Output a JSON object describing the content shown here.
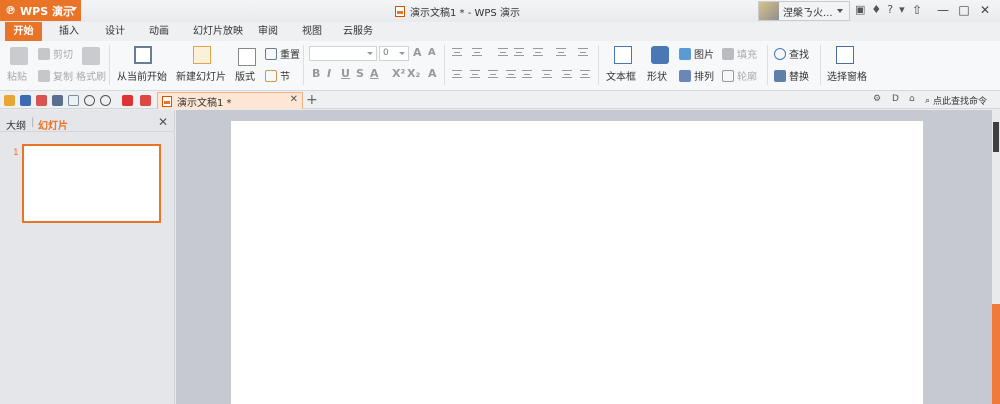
{
  "titlebar": {
    "app_name": "WPS 演示",
    "title": "演示文稿1 * - WPS 演示",
    "user_name": "涅槃ㄋ火..."
  },
  "menu": {
    "tabs": [
      "开始",
      "插入",
      "设计",
      "动画",
      "幻灯片放映",
      "审阅",
      "视图",
      "云服务"
    ],
    "active": "开始"
  },
  "ribbon": {
    "clipboard": {
      "paste": "粘贴",
      "cut": "剪切",
      "copy": "复制",
      "format_painter": "格式刷"
    },
    "slides": {
      "from_current": "从当前开始",
      "new_slide": "新建幻灯片",
      "layout": "版式",
      "reset": "重置",
      "section": "节"
    },
    "font": {
      "font_name": "",
      "font_size": "0"
    },
    "drawing": {
      "textbox": "文本框",
      "shape": "形状",
      "picture": "图片",
      "fill": "填充",
      "arrange": "排列",
      "outline": "轮廓"
    },
    "editing": {
      "find": "查找",
      "replace": "替换",
      "selection_pane": "选择窗格"
    }
  },
  "quickbar": {
    "doc_tab": "演示文稿1 *",
    "find_command": "点此查找命令"
  },
  "left_panel": {
    "tab_outline": "大纲",
    "tab_slides": "幻灯片",
    "slide_number": "1"
  },
  "colors": {
    "accent": "#e97428",
    "workspace": "#c6c9cf"
  }
}
